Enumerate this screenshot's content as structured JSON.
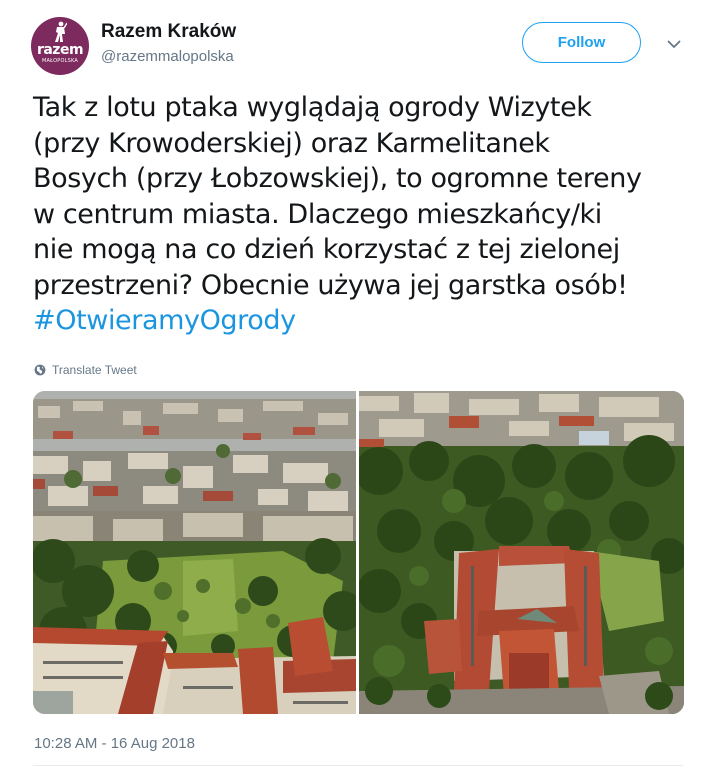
{
  "user": {
    "display_name": "Razem Kraków",
    "username": "@razemmalopolska",
    "avatar_logo_text": "razem",
    "avatar_logo_subtext": "MAŁOPOLSKA"
  },
  "follow_label": "Follow",
  "tweet": {
    "lines": [
      "Tak z lotu ptaka wyglądają ogrody Wizytek",
      "(przy Krowoderskiej) oraz Karmelitanek",
      "Bosych (przy Łobzowskiej), to ogromne tereny",
      "w centrum miasta. Dlaczego mieszkańcy/ki",
      "nie mogą na co dzień korzystać z tej zielonej",
      "przestrzeni? Obecnie używa jej garstka osób!"
    ],
    "hashtag": "#OtwieramyOgrody"
  },
  "translate_label": "Translate Tweet",
  "timestamp": "10:28 AM - 16 Aug 2018",
  "colors": {
    "accent": "#1da1f2",
    "hashtag": "#1b95e0",
    "muted": "#657786",
    "avatar_bg": "#7d2a5e"
  },
  "icons": {
    "caret": "chevron-down-icon",
    "translate": "globe-icon"
  }
}
